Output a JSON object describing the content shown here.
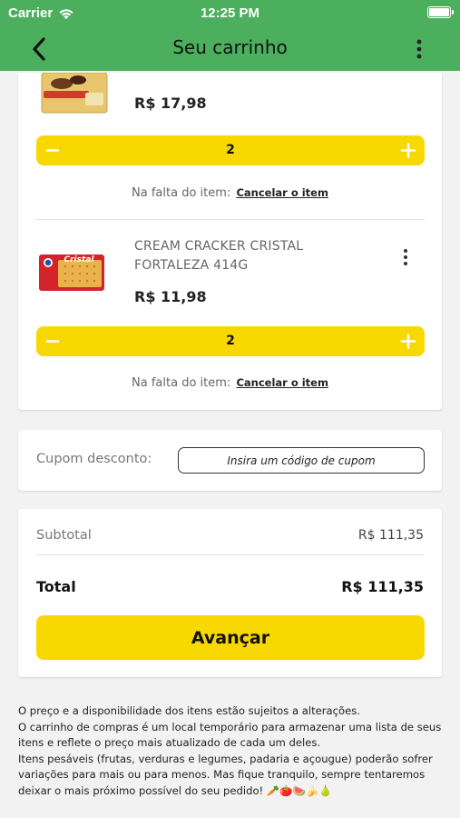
{
  "status_bar": {
    "carrier": "Carrier",
    "time": "12:25 PM",
    "battery_level": 1.0
  },
  "nav": {
    "title": "Seu carrinho",
    "back_icon": "chevron-left-icon",
    "menu_icon": "kebab-menu-icon"
  },
  "items": [
    {
      "name": "",
      "price": "R$ 17,98",
      "quantity": "2",
      "missing_label": "Na falta do item:",
      "missing_action": "Cancelar o item"
    },
    {
      "name": "CREAM CRACKER CRISTAL FORTALEZA 414G",
      "price": "R$ 11,98",
      "quantity": "2",
      "missing_label": "Na falta do item:",
      "missing_action": "Cancelar o item",
      "package_brand": "Cristal"
    }
  ],
  "coupon": {
    "label": "Cupom desconto:",
    "placeholder": "Insira um código de cupom"
  },
  "summary": {
    "subtotal_label": "Subtotal",
    "subtotal_value": "R$ 111,35",
    "total_label": "Total",
    "total_value": "R$ 111,35",
    "advance_label": "Avançar"
  },
  "notice": {
    "line1": "O preço e a disponibilidade dos itens estão sujeitos a alterações.",
    "line2": "O carrinho de compras é um local temporário para armazenar uma lista de seus itens e reflete o preço mais atualizado de cada um deles.",
    "line3": "Itens pesáveis (frutas, verduras e legumes, padaria e açougue)  poderão sofrer variações para mais ou para menos. Mas fique tranquilo, sempre tentaremos deixar o mais próximo possível do seu pedido! 🥕🍅🍉🍌🍐"
  },
  "colors": {
    "header": "#4caf5e",
    "accent": "#f7d800",
    "background": "#f2f2f2"
  }
}
